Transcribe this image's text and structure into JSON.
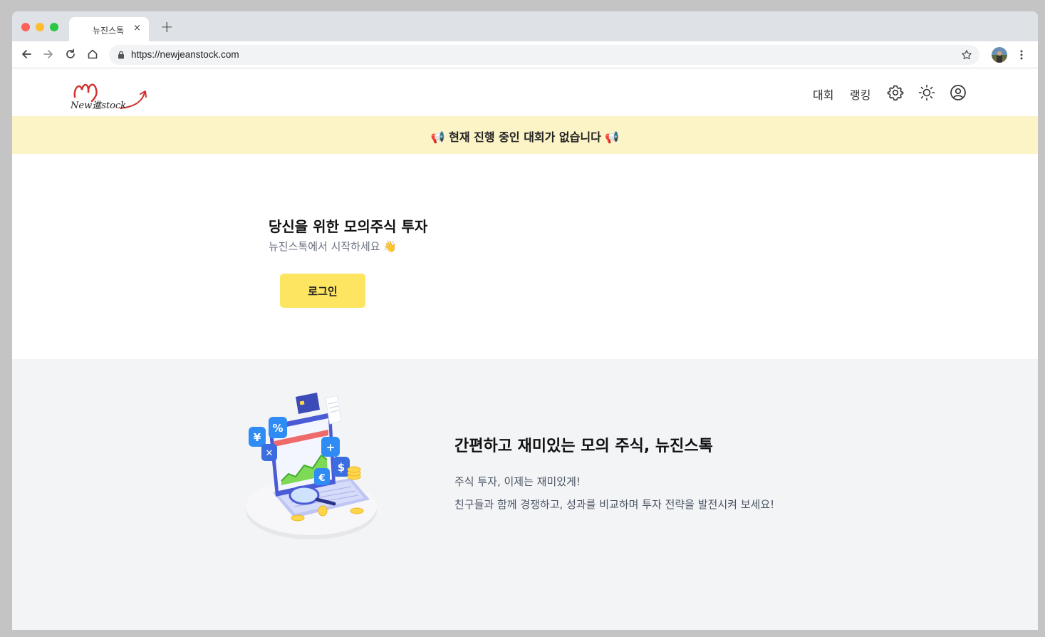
{
  "browser": {
    "tab_title": "뉴진스톡",
    "tab_close": "×",
    "new_tab": "+",
    "url": "https://newjeanstock.com"
  },
  "header": {
    "logo_text": "New進stock",
    "nav": {
      "contest": "대회",
      "ranking": "랭킹"
    },
    "icons": [
      "settings-icon",
      "sun-icon",
      "user-icon"
    ]
  },
  "banner": {
    "text": "📢 현재 진행 중인 대회가 없습니다 📢"
  },
  "hero": {
    "title": "당신을 위한 모의주식 투자",
    "subtitle": "뉴진스톡에서 시작하세요 👋",
    "login_label": "로그인"
  },
  "feature": {
    "title": "간편하고 재미있는 모의 주식, 뉴진스톡",
    "line1": "주식 투자, 이제는 재미있게!",
    "line2": "친구들과 함께 경쟁하고, 성과를 비교하며 투자 전략을 발전시켜 보세요!"
  },
  "colors": {
    "accent": "#fde461",
    "banner_bg": "#fcf3c6",
    "feature_bg": "#f3f4f6",
    "logo_red": "#d32f2f"
  }
}
